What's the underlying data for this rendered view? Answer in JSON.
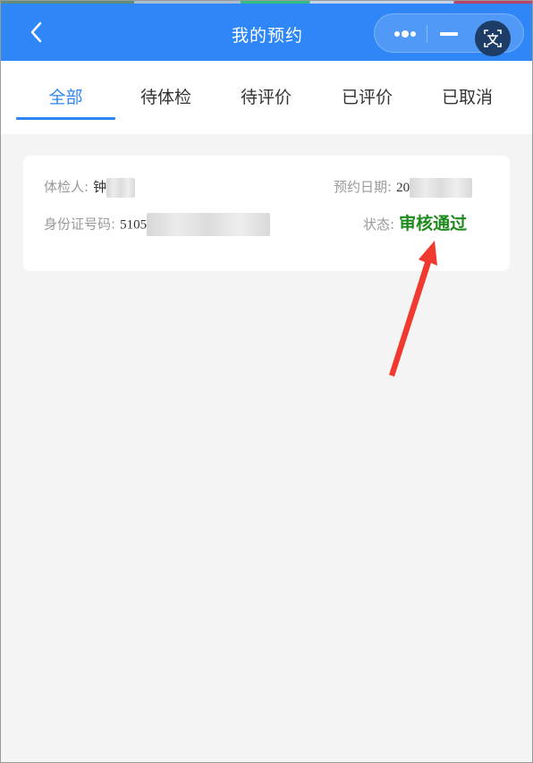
{
  "header": {
    "title": "我的预约",
    "back_icon": "chevron-left-icon",
    "more_icon": "more-dots-icon",
    "minimize_icon": "minimize-icon",
    "translate_icon": "translate-icon",
    "bg_color": "#2f86f6"
  },
  "tabs": [
    {
      "label": "全部",
      "active": true
    },
    {
      "label": "待体检",
      "active": false
    },
    {
      "label": "待评价",
      "active": false
    },
    {
      "label": "已评价",
      "active": false
    },
    {
      "label": "已取消",
      "active": false
    }
  ],
  "appointment": {
    "examinee_label": "体检人:",
    "examinee_value": "钟",
    "date_label": "预约日期:",
    "date_value": "20",
    "id_label": "身份证号码:",
    "id_value": "5105",
    "status_label": "状态:",
    "status_value": "审核通过",
    "status_color": "#1e8a1e"
  },
  "colors": {
    "accent": "#2f86f6",
    "annotation_arrow": "#f03a2f"
  }
}
